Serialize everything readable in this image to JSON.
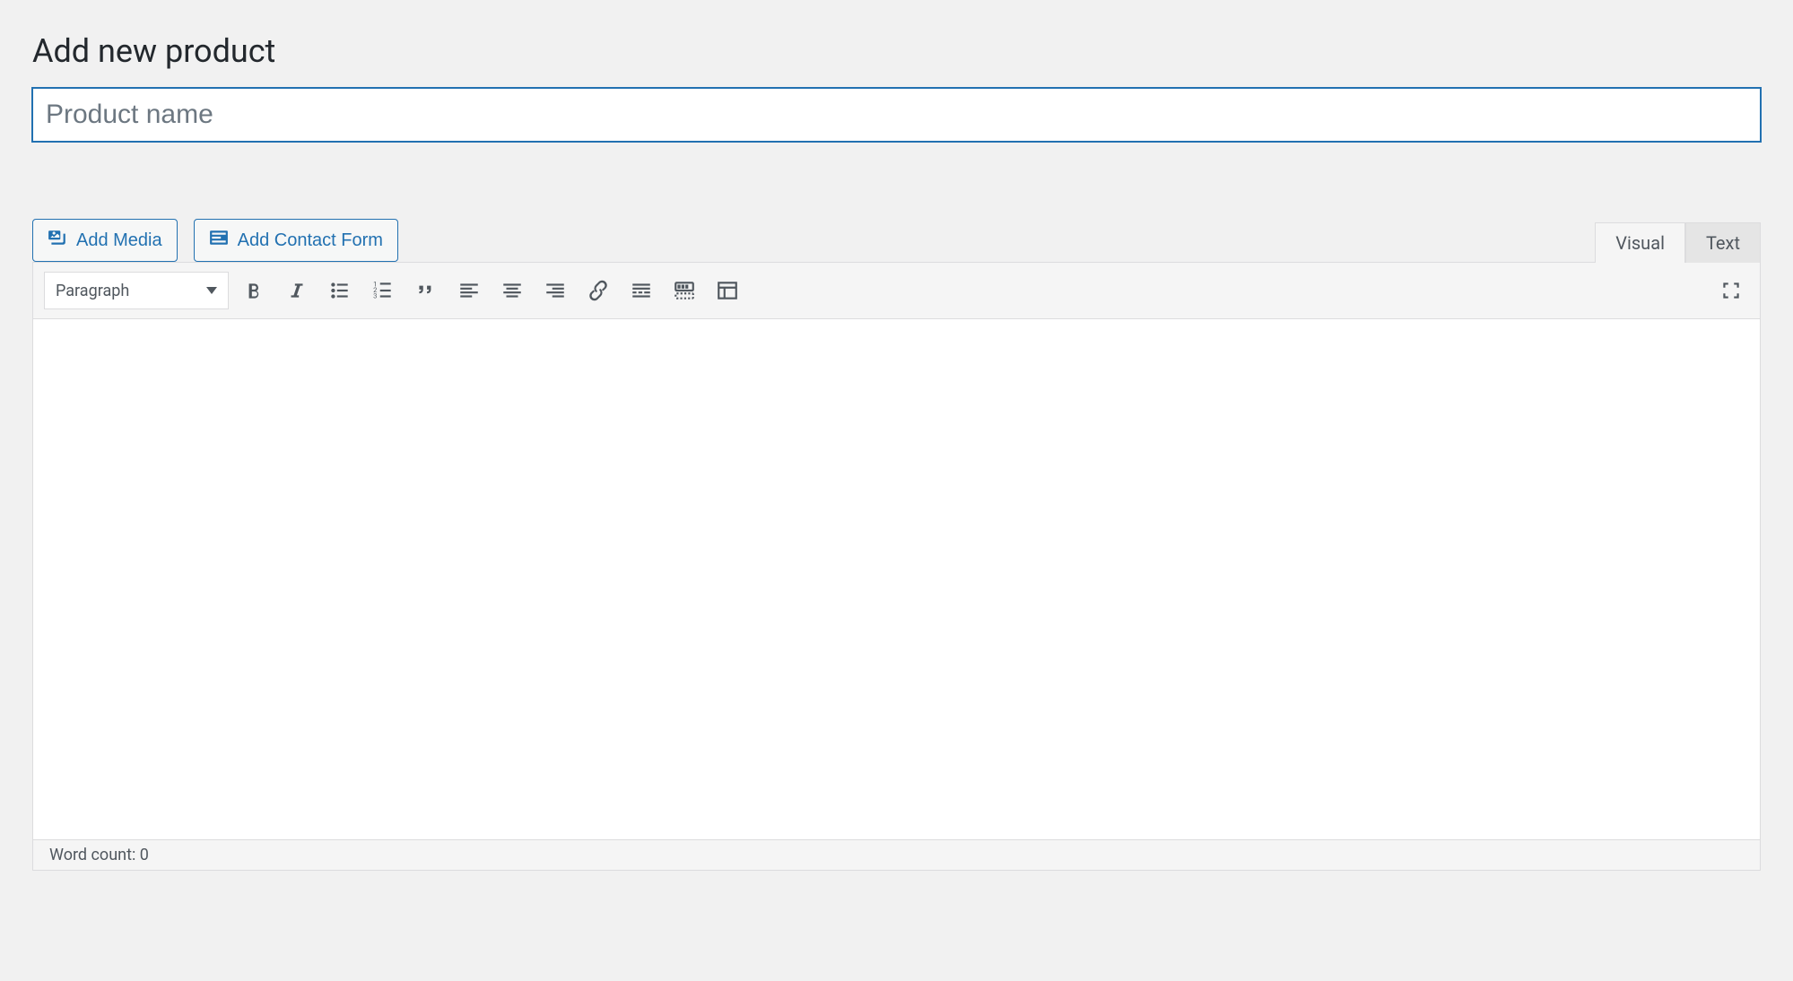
{
  "page": {
    "title": "Add new product"
  },
  "title_field": {
    "placeholder": "Product name",
    "value": ""
  },
  "media_buttons": {
    "add_media": "Add Media",
    "add_contact_form": "Add Contact Form"
  },
  "editor": {
    "tabs": {
      "visual": "Visual",
      "text": "Text",
      "active": "visual"
    },
    "format_select": "Paragraph",
    "toolbar": [
      "bold",
      "italic",
      "bullet-list",
      "numbered-list",
      "blockquote",
      "align-left",
      "align-center",
      "align-right",
      "link",
      "insert-more",
      "toolbar-toggle",
      "table"
    ],
    "content": "",
    "status": {
      "word_count_label": "Word count: ",
      "word_count": "0"
    }
  }
}
